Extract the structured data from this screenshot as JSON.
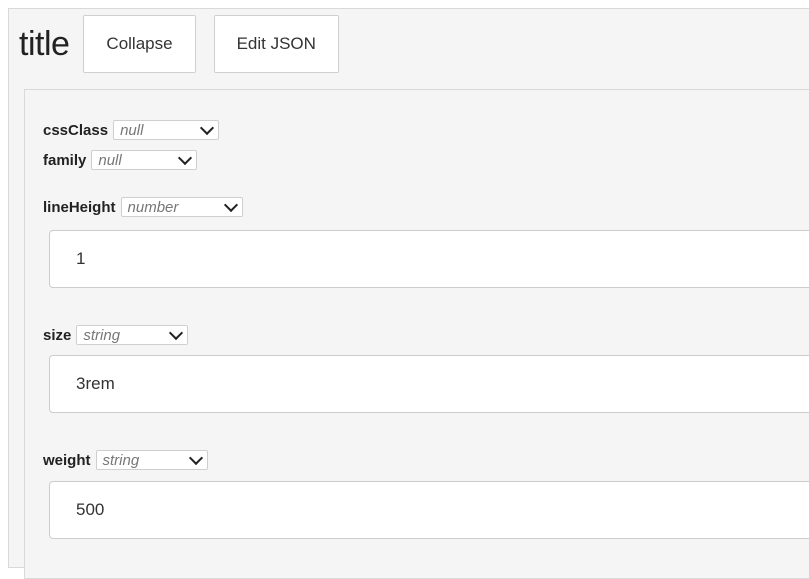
{
  "header": {
    "title": "title",
    "collapse_label": "Collapse",
    "edit_json_label": "Edit JSON"
  },
  "properties": {
    "cssClass": {
      "name": "cssClass",
      "type": "null"
    },
    "family": {
      "name": "family",
      "type": "null"
    },
    "lineHeight": {
      "name": "lineHeight",
      "type": "number",
      "value": "1"
    },
    "size": {
      "name": "size",
      "type": "string",
      "value": "3rem"
    },
    "weight": {
      "name": "weight",
      "type": "string",
      "value": "500"
    }
  },
  "icons": {
    "type_dropdown": "chevron-down-icon"
  },
  "colors": {
    "panel_background": "#f5f5f5",
    "border": "#d9d9d9",
    "type_text": "#777777"
  }
}
